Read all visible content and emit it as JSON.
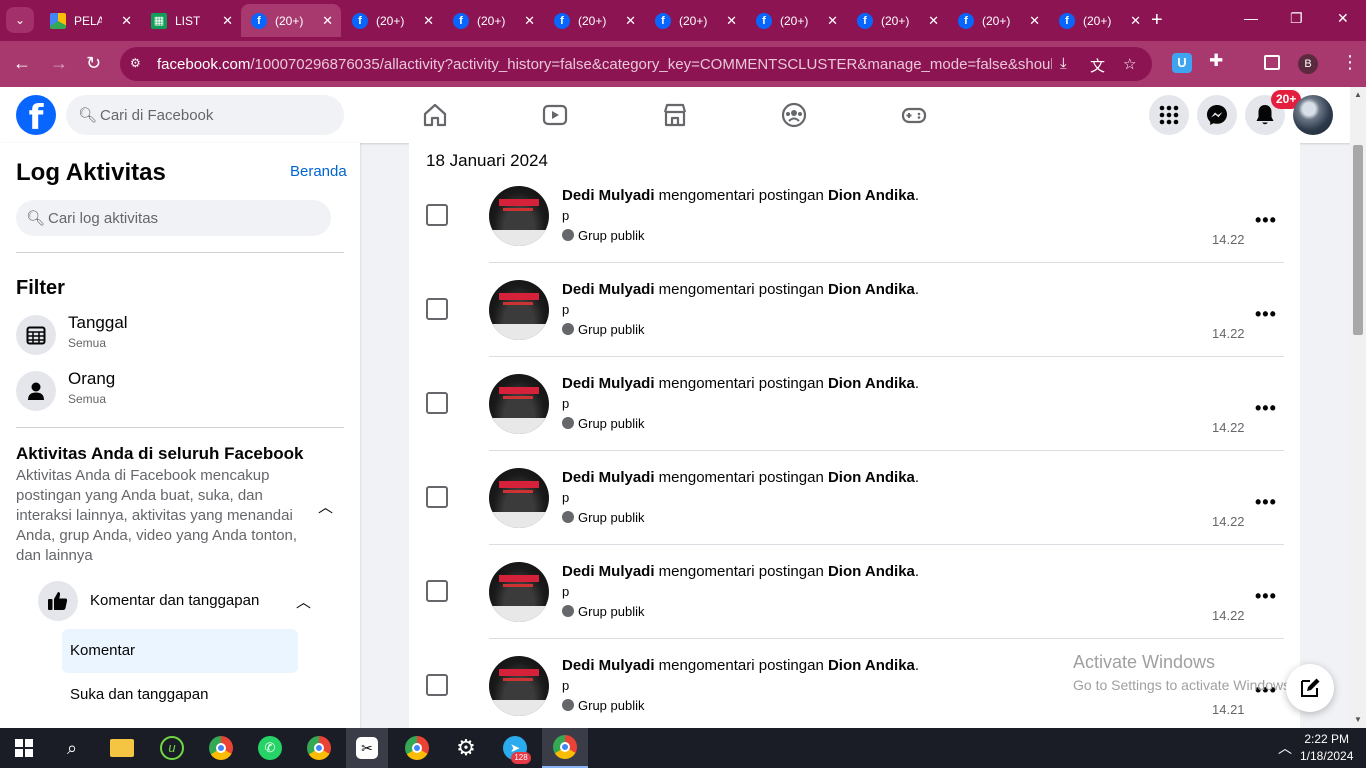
{
  "browser": {
    "tabs": [
      {
        "label": "PELAI",
        "favicon": "drive-icon"
      },
      {
        "label": "LIST C",
        "favicon": "sheets-icon"
      },
      {
        "label": "(20+)",
        "favicon": "facebook-icon",
        "active": true
      },
      {
        "label": "(20+)",
        "favicon": "facebook-icon"
      },
      {
        "label": "(20+)",
        "favicon": "facebook-icon"
      },
      {
        "label": "(20+)",
        "favicon": "facebook-icon"
      },
      {
        "label": "(20+)",
        "favicon": "facebook-icon"
      },
      {
        "label": "(20+)",
        "favicon": "facebook-icon"
      },
      {
        "label": "(20+)",
        "favicon": "facebook-icon"
      },
      {
        "label": "(20+)",
        "favicon": "facebook-icon"
      },
      {
        "label": "(20+)",
        "favicon": "facebook-icon"
      }
    ],
    "url_host": "facebook.com",
    "url_rest": "/100070296876035/allactivity?activity_history=false&category_key=COMMENTSCLUSTER&manage_mode=false&should_load_lan...",
    "profile_initial": "B",
    "theme_color": "#a8396f"
  },
  "header": {
    "search_placeholder": "Cari di Facebook",
    "notification_badge": "20+",
    "nav_icons": [
      "home-icon",
      "video-icon",
      "marketplace-icon",
      "groups-icon",
      "gaming-icon"
    ]
  },
  "left": {
    "title": "Log Aktivitas",
    "home_link": "Beranda",
    "search_placeholder": "Cari log aktivitas",
    "filter_heading": "Filter",
    "filters": [
      {
        "label": "Tanggal",
        "sub": "Semua",
        "icon": "calendar-icon"
      },
      {
        "label": "Orang",
        "sub": "Semua",
        "icon": "person-icon"
      }
    ],
    "section_title": "Aktivitas Anda di seluruh Facebook",
    "section_desc": "Aktivitas Anda di Facebook mencakup postingan yang Anda buat, suka, dan interaksi lainnya, aktivitas yang menandai Anda, grup Anda, video yang Anda tonton, dan lainnya",
    "category": "Komentar dan tanggapan",
    "subitems": [
      "Komentar",
      "Suka dan tanggapan"
    ]
  },
  "main": {
    "date": "18 Januari 2024",
    "rows": [
      {
        "actor": "Dedi Mulyadi",
        "verb": " mengomentari postingan ",
        "target": "Dion Andika",
        "end": ".",
        "comment": "p",
        "audience": "Grup publik",
        "time": "14.22"
      },
      {
        "actor": "Dedi Mulyadi",
        "verb": " mengomentari postingan ",
        "target": "Dion Andika",
        "end": ".",
        "comment": "p",
        "audience": "Grup publik",
        "time": "14.22"
      },
      {
        "actor": "Dedi Mulyadi",
        "verb": " mengomentari postingan ",
        "target": "Dion Andika",
        "end": ".",
        "comment": "p",
        "audience": "Grup publik",
        "time": "14.22"
      },
      {
        "actor": "Dedi Mulyadi",
        "verb": " mengomentari postingan ",
        "target": "Dion Andika",
        "end": ".",
        "comment": "p",
        "audience": "Grup publik",
        "time": "14.22"
      },
      {
        "actor": "Dedi Mulyadi",
        "verb": " mengomentari postingan ",
        "target": "Dion Andika",
        "end": ".",
        "comment": "p",
        "audience": "Grup publik",
        "time": "14.22"
      },
      {
        "actor": "Dedi Mulyadi",
        "verb": " mengomentari postingan ",
        "target": "Dion Andika",
        "end": ".",
        "comment": "p",
        "audience": "Grup publik",
        "time": "14.21"
      }
    ]
  },
  "watermark": {
    "line1": "Activate Windows",
    "line2": "Go to Settings to activate Windows."
  },
  "taskbar": {
    "time": "2:22 PM",
    "date": "1/18/2024",
    "telegram_badge": "128"
  },
  "colors": {
    "fb_blue": "#0866ff",
    "link_blue": "#0064d1",
    "selected_bg": "#ebf5ff"
  }
}
